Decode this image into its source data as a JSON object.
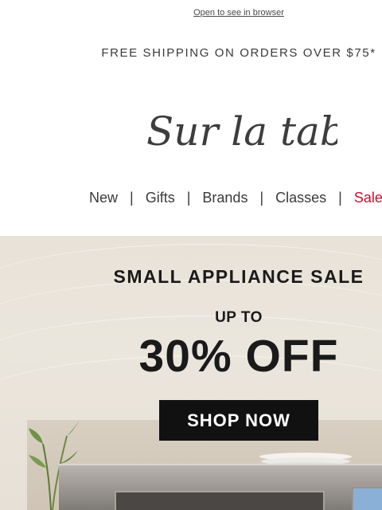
{
  "browser_link": "Open to see in browser",
  "shipping_banner": "FREE SHIPPING ON ORDERS OVER $75*",
  "logo_text": "Sur la table",
  "nav": {
    "items": [
      "New",
      "Gifts",
      "Brands",
      "Classes",
      "Sale"
    ],
    "separator": "|"
  },
  "hero": {
    "title": "SMALL APPLIANCE SALE",
    "up_to": "UP TO",
    "discount": "30% OFF",
    "button": "SHOP NOW"
  },
  "colors": {
    "sale": "#c8102e",
    "button_bg": "#111111",
    "hero_bg": "#e8e2d8"
  }
}
